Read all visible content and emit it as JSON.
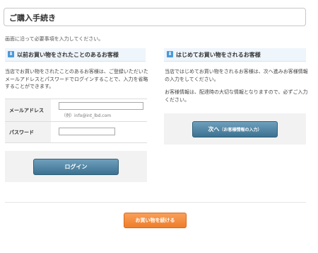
{
  "header": {
    "title": "ご購入手続き"
  },
  "instruction": "画面に沿って必要事項を入力してください。",
  "returning": {
    "heading": "以前お買い物をされたことのあるお客様",
    "description": "当店でお買い物をされたことのあるお客様は、ご登録いただいたメールアドレスとパスワードでログインすることで、入力を省略することができます。",
    "email_label": "メールアドレス",
    "email_value": "",
    "email_example": "（例）info@int_lbd.com",
    "password_label": "パスワード",
    "password_value": "",
    "login_button": "ログイン"
  },
  "first_time": {
    "heading": "はじめてお買い物をされるお客様",
    "description1": "当店ではじめてお買い物をされるお客様は、次へ進みお客様情報の入力をしてください。",
    "description2": "お客様情報は、配達時の大切な情報となりますので、必ずご入力ください。",
    "next_button_main": "次へ",
    "next_button_sub": "（お客様情報の入力）"
  },
  "footer": {
    "continue_button": "お買い物を続ける"
  },
  "icons": {
    "heading_icon": "download-arrow-icon"
  },
  "colors": {
    "accent_blue": "#3c7190",
    "accent_orange": "#ee7d2a",
    "heading_bg": "#eef5fb"
  }
}
